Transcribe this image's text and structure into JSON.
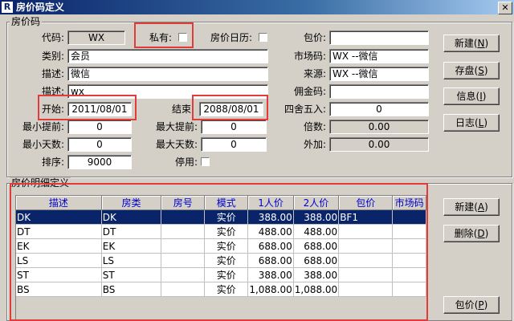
{
  "window": {
    "title": "房价码定义",
    "app_icon": "R",
    "close_glyph": "✕"
  },
  "header_group": {
    "title": "房价码"
  },
  "fields": {
    "code": {
      "label": "代码:",
      "value": "WX"
    },
    "private": {
      "label": "私有:"
    },
    "daily_rate": {
      "label": "房价日历:"
    },
    "package": {
      "label": "包价:",
      "value": ""
    },
    "category": {
      "label": "类别:",
      "value": "会员"
    },
    "market_code": {
      "label": "市场码:",
      "value": "WX --微信"
    },
    "description": {
      "label": "描述:",
      "value": "微信"
    },
    "source": {
      "label": "来源:",
      "value": "WX --微信"
    },
    "description2": {
      "label": "描述:",
      "value": "wx"
    },
    "commission_code": {
      "label": "佣金码:",
      "value": ""
    },
    "start": {
      "label": "开始:",
      "value": "2011/08/01"
    },
    "end": {
      "label": "结束:",
      "value": "2088/08/01"
    },
    "rounding": {
      "label": "四舍五入:",
      "value": "0"
    },
    "min_advance": {
      "label": "最小提前:",
      "value": "0"
    },
    "max_advance": {
      "label": "最大提前:",
      "value": "0"
    },
    "multiplier": {
      "label": "倍数:",
      "value": "0.00"
    },
    "min_days": {
      "label": "最小天数:",
      "value": "0"
    },
    "max_days": {
      "label": "最大天数:",
      "value": "0"
    },
    "add": {
      "label": "外加:",
      "value": "0.00"
    },
    "sort": {
      "label": "排序:",
      "value": "9000"
    },
    "disabled": {
      "label": "停用:"
    }
  },
  "top_buttons": {
    "new": {
      "label": "新建",
      "key": "N"
    },
    "save": {
      "label": "存盘",
      "key": "S"
    },
    "info": {
      "label": "信息",
      "key": "I"
    },
    "log": {
      "label": "日志",
      "key": "L"
    }
  },
  "detail_group": {
    "title": "房价明细定义"
  },
  "detail_table": {
    "headers": [
      "描述",
      "房类",
      "房号",
      "模式",
      "1人价",
      "2人价",
      "包价",
      "市场码"
    ],
    "rows": [
      [
        "DK",
        "DK",
        "",
        "实价",
        "388.00",
        "388.00",
        "BF1",
        ""
      ],
      [
        "DT",
        "DT",
        "",
        "实价",
        "488.00",
        "488.00",
        "",
        ""
      ],
      [
        "EK",
        "EK",
        "",
        "实价",
        "688.00",
        "688.00",
        "",
        ""
      ],
      [
        "LS",
        "LS",
        "",
        "实价",
        "688.00",
        "688.00",
        "",
        ""
      ],
      [
        "ST",
        "ST",
        "",
        "实价",
        "388.00",
        "388.00",
        "",
        ""
      ],
      [
        "BS",
        "BS",
        "",
        "实价",
        "1,088.00",
        "1,088.00",
        "",
        ""
      ]
    ],
    "selected_row": 0
  },
  "detail_buttons": {
    "new": {
      "label": "新建",
      "key": "A"
    },
    "delete": {
      "label": "删除",
      "key": "D"
    },
    "package": {
      "label": "包价",
      "key": "P"
    }
  },
  "colors": {
    "highlight_box": "#e23b3b",
    "selection": "#0a246a",
    "header_text": "#0000cc"
  }
}
